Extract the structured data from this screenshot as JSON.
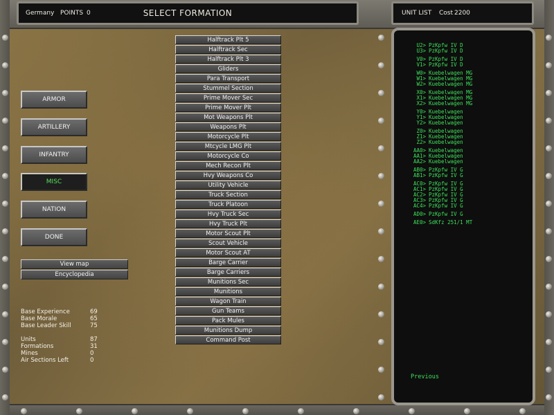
{
  "header": {
    "nation": "Germany",
    "points_label": "POINTS",
    "points": "0",
    "title": "SELECT FORMATION",
    "unit_list_label": "UNIT LIST",
    "cost_label": "Cost",
    "cost": "2200"
  },
  "categories": [
    {
      "label": "ARMOR",
      "active": false
    },
    {
      "label": "ARTILLERY",
      "active": false
    },
    {
      "label": "INFANTRY",
      "active": false
    },
    {
      "label": "MISC",
      "active": true
    },
    {
      "label": "NATION",
      "active": false
    },
    {
      "label": "DONE",
      "active": false
    }
  ],
  "utility_buttons": {
    "view_map": "View map",
    "encyclopedia": "Encyclopedia"
  },
  "stats": {
    "base": [
      {
        "label": "Base Experience",
        "value": "69"
      },
      {
        "label": "Base Morale",
        "value": "65"
      },
      {
        "label": "Base Leader Skill",
        "value": "75"
      }
    ],
    "counts": [
      {
        "label": "Units",
        "value": "87"
      },
      {
        "label": "Formations",
        "value": "31"
      },
      {
        "label": "Mines",
        "value": "0"
      },
      {
        "label": "Air Sections Left",
        "value": "0"
      }
    ]
  },
  "formations": [
    "Halftrack Plt 5",
    "Halftrack Sec",
    "Halftrack Plt 3",
    "Gliders",
    "Para Transport",
    "Stummel Section",
    "Prime Mover Sec",
    "Prime Mover Plt",
    "Mot Weapons Plt",
    "Weapons Plt",
    "Motorcycle Plt",
    "Mtcycle LMG Plt",
    "Motorcycle Co",
    "Mech Recon Plt",
    "Hvy Weapons Co",
    "Utility Vehicle",
    "Truck Section",
    "Truck Platoon",
    "Hvy Truck Sec",
    "Hvy Truck Plt",
    "Motor Scout Plt",
    "Scout Vehicle",
    "Motor Scout AT",
    "Barge Carrier",
    "Barge Carriers",
    "Munitions Sec",
    "Munitions",
    "Wagon Train",
    "Gun Teams",
    "Pack Mules",
    "Munitions Dump",
    "Command Post"
  ],
  "unit_groups": [
    [
      {
        "id": "U2>",
        "name": "PzKpfw IV D"
      },
      {
        "id": "U3>",
        "name": "PzKpfw IV D"
      }
    ],
    [
      {
        "id": "V0>",
        "name": "PzKpfw IV D"
      },
      {
        "id": "V1>",
        "name": "PzKpfw IV D"
      }
    ],
    [
      {
        "id": "W0>",
        "name": "Kuebelwagen MG"
      },
      {
        "id": "W1>",
        "name": "Kuebelwagen MG"
      },
      {
        "id": "W2>",
        "name": "Kuebelwagen MG"
      }
    ],
    [
      {
        "id": "X0>",
        "name": "Kuebelwagen MG"
      },
      {
        "id": "X1>",
        "name": "Kuebelwagen MG"
      },
      {
        "id": "X2>",
        "name": "Kuebelwagen MG"
      }
    ],
    [
      {
        "id": "Y0>",
        "name": "Kuebelwagen"
      },
      {
        "id": "Y1>",
        "name": "Kuebelwagen"
      },
      {
        "id": "Y2>",
        "name": "Kuebelwagen"
      }
    ],
    [
      {
        "id": "Z0>",
        "name": "Kuebelwagen"
      },
      {
        "id": "Z1>",
        "name": "Kuebelwagen"
      },
      {
        "id": "Z2>",
        "name": "Kuebelwagen"
      }
    ],
    [
      {
        "id": "AA0>",
        "name": "Kuebelwagen"
      },
      {
        "id": "AA1>",
        "name": "Kuebelwagen"
      },
      {
        "id": "AA2>",
        "name": "Kuebelwagen"
      }
    ],
    [
      {
        "id": "AB0>",
        "name": "PzKpfw IV G"
      },
      {
        "id": "AB1>",
        "name": "PzKpfw IV G"
      }
    ],
    [
      {
        "id": "AC0>",
        "name": "PzKpfw IV G"
      },
      {
        "id": "AC1>",
        "name": "PzKpfw IV G"
      },
      {
        "id": "AC2>",
        "name": "PzKpfw IV G"
      },
      {
        "id": "AC3>",
        "name": "PzKpfw IV G"
      },
      {
        "id": "AC4>",
        "name": "PzKpfw IV G"
      }
    ],
    [
      {
        "id": "AD0>",
        "name": "PzKpfw IV G"
      }
    ],
    [
      {
        "id": "AE0>",
        "name": "SdKfz 251/1 MT"
      }
    ]
  ],
  "previous_label": "Previous",
  "colors": {
    "green_text": "#3ee05a",
    "active_button": "#1e1e1e"
  }
}
